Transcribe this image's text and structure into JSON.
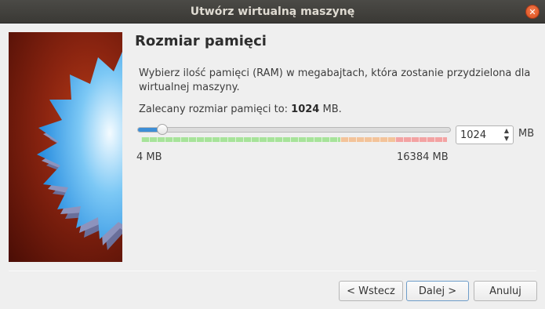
{
  "window": {
    "title": "Utwórz wirtualną maszynę",
    "close_glyph": "✕"
  },
  "page": {
    "title": "Rozmiar pamięci",
    "description": "Wybierz ilość pamięci (RAM) w megabajtach, która zostanie przydzielona dla wirtualnej maszyny.",
    "recommend_prefix": "Zalecany rozmiar pamięci to: ",
    "recommend_value": "1024",
    "recommend_suffix": " MB."
  },
  "memory": {
    "min_label": "4 MB",
    "max_label": "16384 MB",
    "value": "1024",
    "unit": "MB",
    "slider_fraction": 0.08,
    "zones": {
      "green": 0.65,
      "orange": 0.18,
      "red": 0.17
    }
  },
  "buttons": {
    "back": "< Wstecz",
    "next": "Dalej >",
    "cancel": "Anuluj"
  },
  "colors": {
    "slider_fill": "#3d8ed6",
    "zone_green": "#a7e39a",
    "zone_orange": "#f3c39a",
    "zone_red": "#f3a3a3",
    "close_button": "#dc4f1c"
  },
  "icons": {
    "close": "close-icon",
    "spin_up": "▲",
    "spin_down": "▼",
    "banner": "virtualbox-starburst-logo"
  }
}
